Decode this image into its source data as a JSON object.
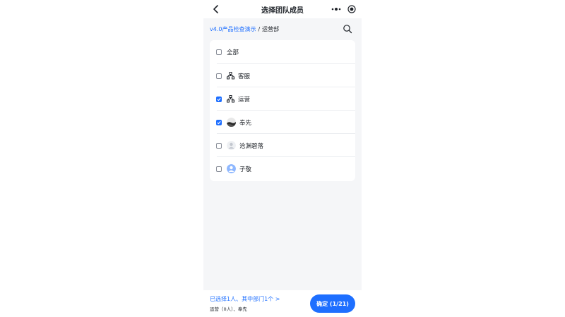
{
  "nav": {
    "title": "选择团队成员",
    "back_icon": "chevron-left-icon",
    "more_icon": "more-dots-icon",
    "target_icon": "target-icon"
  },
  "breadcrumb": {
    "parent": "v4.0产品检查演示",
    "separator": "/",
    "current": "运营部",
    "search_icon": "search-icon"
  },
  "list": {
    "items": [
      {
        "label": "全部",
        "checked": false,
        "icon": "none"
      },
      {
        "label": "客服",
        "checked": false,
        "icon": "org-chart-icon"
      },
      {
        "label": "运营",
        "checked": true,
        "icon": "org-chart-icon"
      },
      {
        "label": "奉先",
        "checked": true,
        "icon": "avatar-photo"
      },
      {
        "label": "沧渊碧落",
        "checked": false,
        "icon": "avatar-default"
      },
      {
        "label": "子敬",
        "checked": false,
        "icon": "avatar-blue"
      }
    ]
  },
  "bottom": {
    "summary": "已选择1人、其中部门1个 >",
    "detail": "运营（0人）、奉先",
    "confirm_label": "确定 (1/21)"
  },
  "colors": {
    "accent": "#1e6fff",
    "background": "#f5f6f8",
    "text": "#1f2329"
  }
}
